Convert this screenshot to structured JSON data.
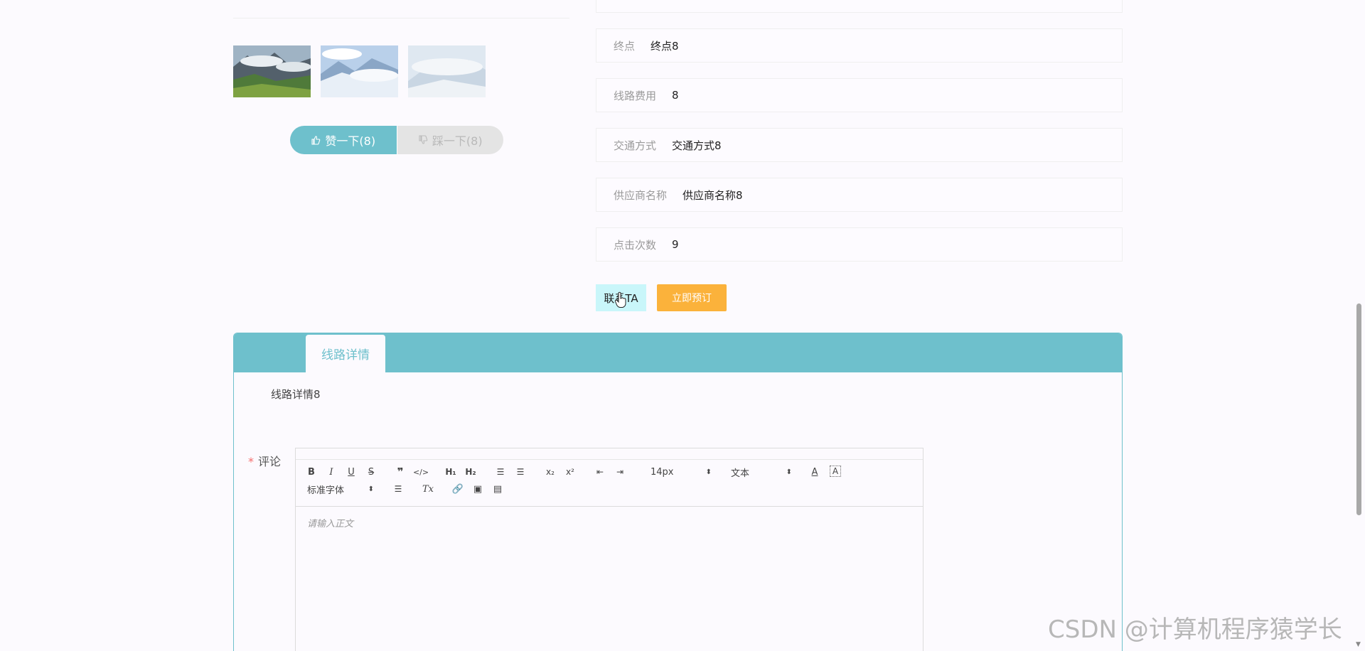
{
  "gallery": {
    "images": [
      {
        "name": "mountain-forest-clouds"
      },
      {
        "name": "snowy-mountain-clouds"
      },
      {
        "name": "snowy-peak-haze"
      }
    ]
  },
  "votes": {
    "like_label": "赞一下(8)",
    "dislike_label": "踩一下(8)"
  },
  "fields": [
    {
      "label": "终点",
      "value": "终点8"
    },
    {
      "label": "线路费用",
      "value": "8"
    },
    {
      "label": "交通方式",
      "value": "交通方式8"
    },
    {
      "label": "供应商名称",
      "value": "供应商名称8"
    },
    {
      "label": "点击次数",
      "value": "9"
    }
  ],
  "actions": {
    "contact_label": "联系TA",
    "book_label": "立即预订"
  },
  "detail": {
    "tab_label": "线路详情",
    "content": "线路详情8"
  },
  "comment": {
    "required_mark": "*",
    "label": "评论",
    "placeholder": "请输入正文",
    "font_size_value": "14px",
    "heading_value": "文本",
    "font_family_value": "标准字体"
  },
  "watermark": "CSDN @计算机程序猿学长",
  "colors": {
    "accent": "#6ec0cc",
    "book_button": "#fbb23b",
    "contact_button": "#c9f6fa",
    "required": "#f56c6c"
  }
}
